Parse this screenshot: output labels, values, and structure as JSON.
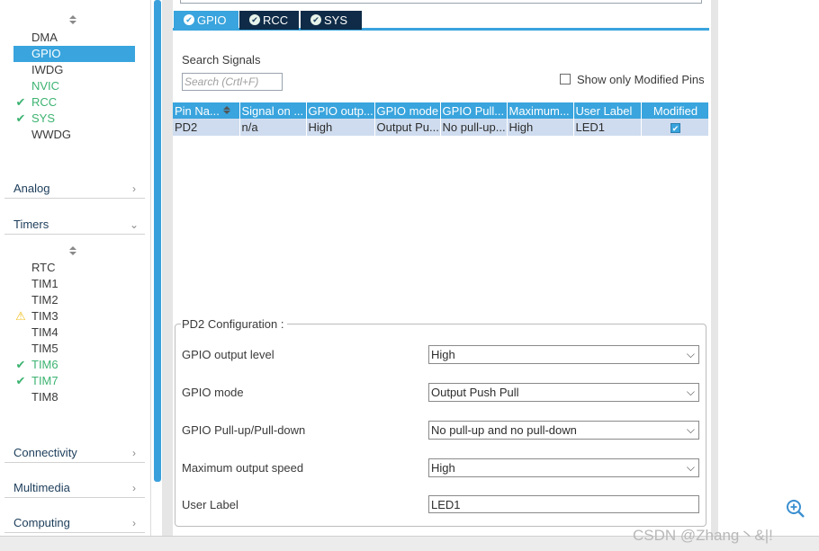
{
  "left_panel": {
    "system_core_items": [
      {
        "label": "DMA",
        "status": "none"
      },
      {
        "label": "GPIO",
        "status": "selected"
      },
      {
        "label": "IWDG",
        "status": "none"
      },
      {
        "label": "NVIC",
        "status": "configured"
      },
      {
        "label": "RCC",
        "status": "checked"
      },
      {
        "label": "SYS",
        "status": "checked"
      },
      {
        "label": "WWDG",
        "status": "none"
      }
    ],
    "categories": {
      "analog": "Analog",
      "timers": "Timers",
      "connectivity": "Connectivity",
      "multimedia": "Multimedia",
      "computing": "Computing"
    },
    "timer_items": [
      {
        "label": "RTC",
        "status": "none"
      },
      {
        "label": "TIM1",
        "status": "none"
      },
      {
        "label": "TIM2",
        "status": "none"
      },
      {
        "label": "TIM3",
        "status": "warning"
      },
      {
        "label": "TIM4",
        "status": "none"
      },
      {
        "label": "TIM5",
        "status": "none"
      },
      {
        "label": "TIM6",
        "status": "checked"
      },
      {
        "label": "TIM7",
        "status": "checked"
      },
      {
        "label": "TIM8",
        "status": "none"
      }
    ],
    "marks": {
      "check": "✔",
      "warning": "⚠"
    }
  },
  "tabs": [
    {
      "label": "GPIO",
      "active": true
    },
    {
      "label": "RCC",
      "active": false
    },
    {
      "label": "SYS",
      "active": false
    }
  ],
  "search": {
    "title": "Search Signals",
    "placeholder": "Search (Crtl+F)",
    "show_modified_label": "Show only Modified Pins"
  },
  "table": {
    "headers": [
      "Pin Na...",
      "Signal on ...",
      "GPIO outp...",
      "GPIO mode",
      "GPIO Pull...",
      "Maximum...",
      "User Label",
      "Modified"
    ],
    "rows": [
      {
        "cells": [
          "PD2",
          "n/a",
          "High",
          "Output Pu...",
          "No pull-up...",
          "High",
          "LED1"
        ],
        "modified": true
      }
    ]
  },
  "config": {
    "title": "PD2 Configuration :",
    "output_level": {
      "label": "GPIO output level",
      "value": "High"
    },
    "mode": {
      "label": "GPIO mode",
      "value": "Output Push Pull"
    },
    "pull": {
      "label": "GPIO Pull-up/Pull-down",
      "value": "No pull-up and no pull-down"
    },
    "speed": {
      "label": "Maximum output speed",
      "value": "High"
    },
    "user_label": {
      "label": "User Label",
      "value": "LED1"
    }
  },
  "icons": {
    "chevron_right": "›",
    "chevron_down": "⌄",
    "dropdown_arrow": "⌵"
  },
  "watermark": "CSDN @Zhang丶&|!",
  "colors": {
    "accent": "#39a4dd",
    "tab_dark": "#0f2b47",
    "row_bg": "#cfdcef",
    "check_green": "#3cb371",
    "warning_yellow": "#f0c020"
  }
}
